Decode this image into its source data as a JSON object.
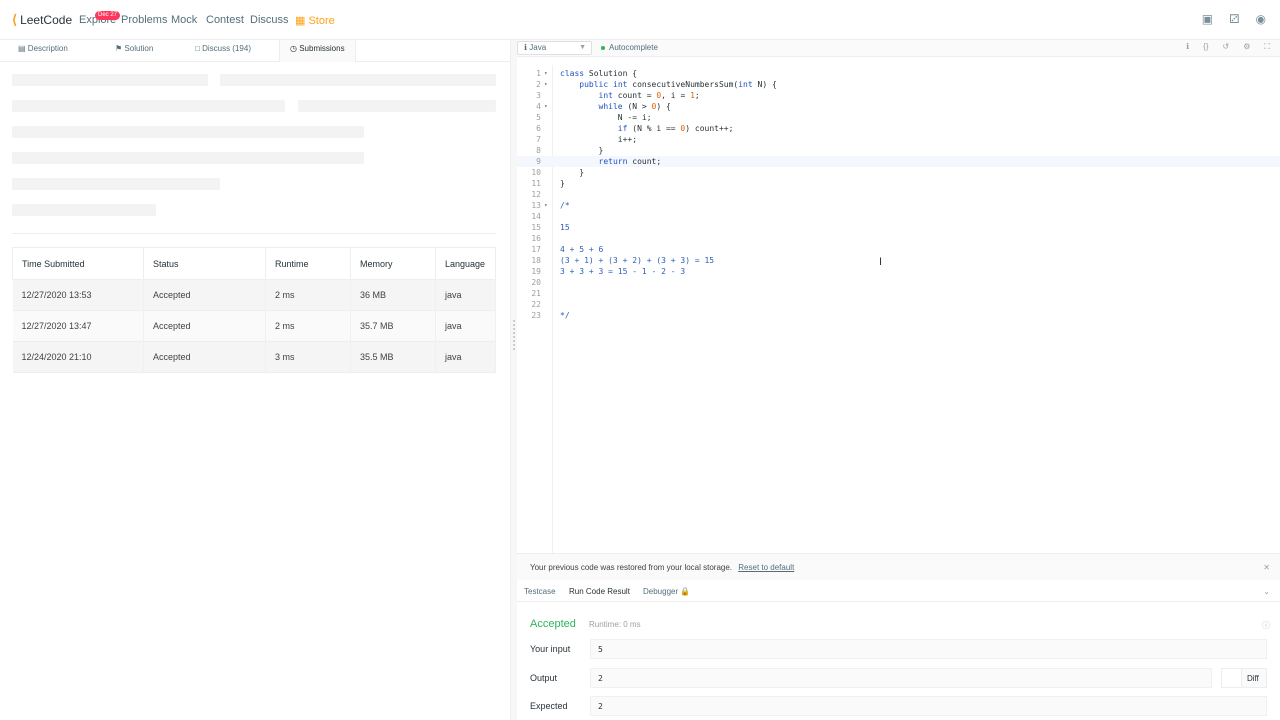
{
  "nav": {
    "logo": "LeetCode",
    "explore": "Explore",
    "explore_badge": "Dec 27",
    "problems": "Problems",
    "mock": "Mock",
    "contest": "Contest",
    "discuss": "Discuss",
    "store": "Store"
  },
  "tabs": {
    "description": "Description",
    "solution": "Solution",
    "discuss": "Discuss (194)",
    "submissions": "Submissions"
  },
  "table": {
    "headers": [
      "Time Submitted",
      "Status",
      "Runtime",
      "Memory",
      "Language"
    ],
    "rows": [
      [
        "12/27/2020 13:53",
        "Accepted",
        "2 ms",
        "36 MB",
        "java"
      ],
      [
        "12/27/2020 13:47",
        "Accepted",
        "2 ms",
        "35.7 MB",
        "java"
      ],
      [
        "12/24/2020 21:10",
        "Accepted",
        "3 ms",
        "35.5 MB",
        "java"
      ]
    ]
  },
  "editor": {
    "language": "Java",
    "autocomplete": "Autocomplete"
  },
  "notice": {
    "text": "Your previous code was restored from your local storage.",
    "link": "Reset to default"
  },
  "result_tabs": {
    "testcase": "Testcase",
    "run_result": "Run Code Result",
    "debugger": "Debugger"
  },
  "result": {
    "status": "Accepted",
    "runtime": "Runtime: 0 ms",
    "input_label": "Your input",
    "input_value": "5",
    "output_label": "Output",
    "output_value": "2",
    "expected_label": "Expected",
    "expected_value": "2",
    "diff": "Diff"
  },
  "colors": {
    "accent": "#ffa116",
    "accepted": "#2db55d"
  }
}
